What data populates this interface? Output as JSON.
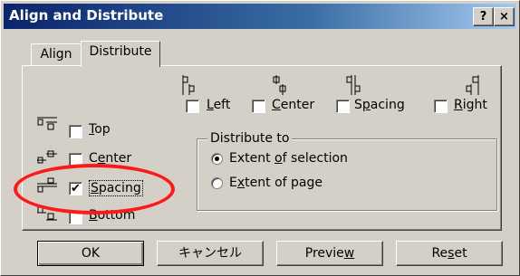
{
  "window": {
    "title": "Align and Distribute",
    "help_label": "?",
    "close_label": "×"
  },
  "tabs": [
    {
      "label": "Align",
      "active": false
    },
    {
      "label": "Distribute",
      "active": true
    }
  ],
  "horizontal_options": [
    {
      "label": "Left",
      "mnemonic": "L",
      "checked": false,
      "icon": "distribute-left-icon"
    },
    {
      "label": "Center",
      "mnemonic": "C",
      "checked": false,
      "icon": "distribute-center-h-icon"
    },
    {
      "label": "Spacing",
      "mnemonic": "p",
      "checked": false,
      "icon": "distribute-spacing-h-icon"
    },
    {
      "label": "Right",
      "mnemonic": "R",
      "checked": false,
      "icon": "distribute-right-icon"
    }
  ],
  "vertical_options": [
    {
      "label": "Top",
      "mnemonic": "T",
      "checked": false,
      "icon": "distribute-top-icon"
    },
    {
      "label": "Center",
      "mnemonic": "e",
      "checked": false,
      "icon": "distribute-center-v-icon"
    },
    {
      "label": "Spacing",
      "mnemonic": "S",
      "checked": true,
      "icon": "distribute-spacing-v-icon"
    },
    {
      "label": "Bottom",
      "mnemonic": "B",
      "checked": false,
      "icon": "distribute-bottom-icon"
    }
  ],
  "distribute_to": {
    "title": "Distribute to",
    "options": [
      {
        "label": "Extent of selection",
        "selected": true
      },
      {
        "label": "Extent of page",
        "selected": false
      }
    ]
  },
  "buttons": {
    "ok": "OK",
    "cancel": "キャンセル",
    "preview": "Preview",
    "reset": "Reset"
  },
  "colors": {
    "titlebar_start": "#0a246a",
    "titlebar_end": "#a6caf0",
    "dialog_face": "#d4d0c8",
    "annotation": "#ff1a1a"
  }
}
